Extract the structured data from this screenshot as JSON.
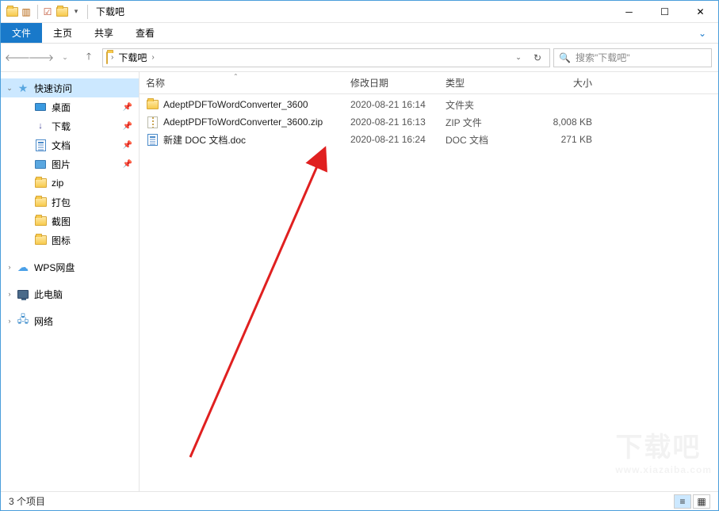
{
  "window": {
    "title": "下载吧"
  },
  "ribbon": {
    "file": "文件",
    "tabs": [
      "主页",
      "共享",
      "查看"
    ]
  },
  "address": {
    "crumbs": [
      "下载吧"
    ],
    "search_placeholder": "搜索\"下载吧\""
  },
  "sidebar": {
    "quickaccess": "快速访问",
    "items": [
      {
        "label": "桌面",
        "icon": "desktop",
        "pinned": true
      },
      {
        "label": "下载",
        "icon": "download",
        "pinned": true
      },
      {
        "label": "文档",
        "icon": "doc",
        "pinned": true
      },
      {
        "label": "图片",
        "icon": "bluefolder",
        "pinned": true
      },
      {
        "label": "zip",
        "icon": "folder",
        "pinned": false
      },
      {
        "label": "打包",
        "icon": "folder",
        "pinned": false
      },
      {
        "label": "截图",
        "icon": "folder",
        "pinned": false
      },
      {
        "label": "图标",
        "icon": "folder",
        "pinned": false
      }
    ],
    "wps": "WPS网盘",
    "thispc": "此电脑",
    "network": "网络"
  },
  "columns": {
    "name": "名称",
    "date": "修改日期",
    "type": "类型",
    "size": "大小"
  },
  "files": [
    {
      "name": "AdeptPDFToWordConverter_3600",
      "date": "2020-08-21 16:14",
      "type": "文件夹",
      "size": "",
      "icon": "folder"
    },
    {
      "name": "AdeptPDFToWordConverter_3600.zip",
      "date": "2020-08-21 16:13",
      "type": "ZIP 文件",
      "size": "8,008 KB",
      "icon": "zip"
    },
    {
      "name": "新建 DOC 文档.doc",
      "date": "2020-08-21 16:24",
      "type": "DOC 文档",
      "size": "271 KB",
      "icon": "doc"
    }
  ],
  "status": {
    "count": "3 个项目"
  },
  "watermark": {
    "main": "下载吧",
    "sub": "www.xiazaiba.com"
  }
}
